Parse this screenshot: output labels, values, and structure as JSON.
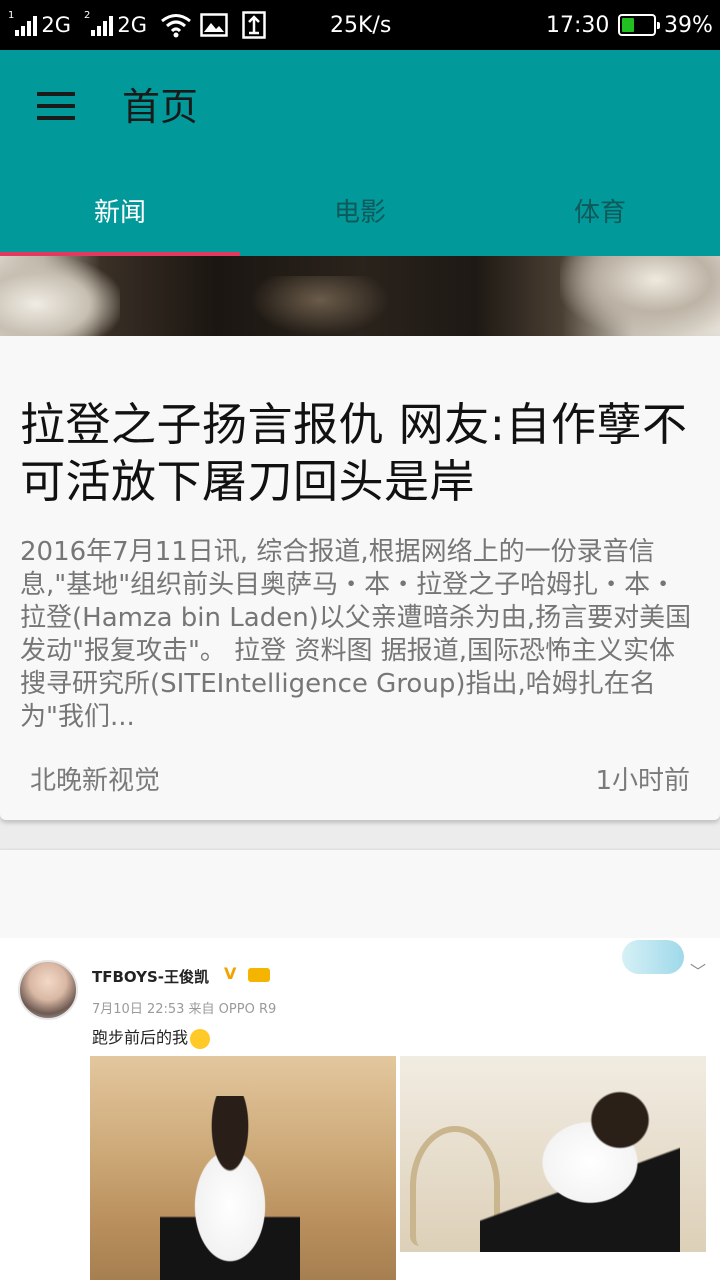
{
  "status_bar": {
    "sim1_label": "2G",
    "sim1_index": "1",
    "sim2_label": "2G",
    "sim2_index": "2",
    "net_speed": "25K/s",
    "time": "17:30",
    "battery": "39%",
    "battery_level": 0.39,
    "icons": [
      "signal-icon",
      "signal-icon",
      "wifi-icon",
      "image-icon",
      "upload-icon",
      "battery-icon"
    ]
  },
  "app_bar": {
    "title": "首页",
    "tabs": [
      {
        "label": "新闻",
        "active": true
      },
      {
        "label": "电影",
        "active": false
      },
      {
        "label": "体育",
        "active": false
      }
    ],
    "accent_color": "#02999a",
    "indicator_color": "#e23a5e"
  },
  "articles": [
    {
      "title": "拉登之子扬言报仇 网友:自作孽不可活放下屠刀回头是岸",
      "summary": "2016年7月11日讯, 综合报道,根据网络上的一份录音信息,\"基地\"组织前头目奥萨马・本・拉登之子哈姆扎・本・拉登(Hamza bin Laden)以父亲遭暗杀为由,扬言要对美国发动\"报复攻击\"。 拉登 资料图 据报道,国际恐怖主义实体搜寻研究所(SITEIntelligence Group)指出,哈姆扎在名为\"我们...",
      "source": "北晚新视觉",
      "time": "1小时前"
    }
  ],
  "weibo_post": {
    "user": "TFBOYS-王俊凯",
    "verified": "V",
    "meta": "7月10日 22:53 来自 OPPO R9",
    "text": "跑步前后的我"
  }
}
